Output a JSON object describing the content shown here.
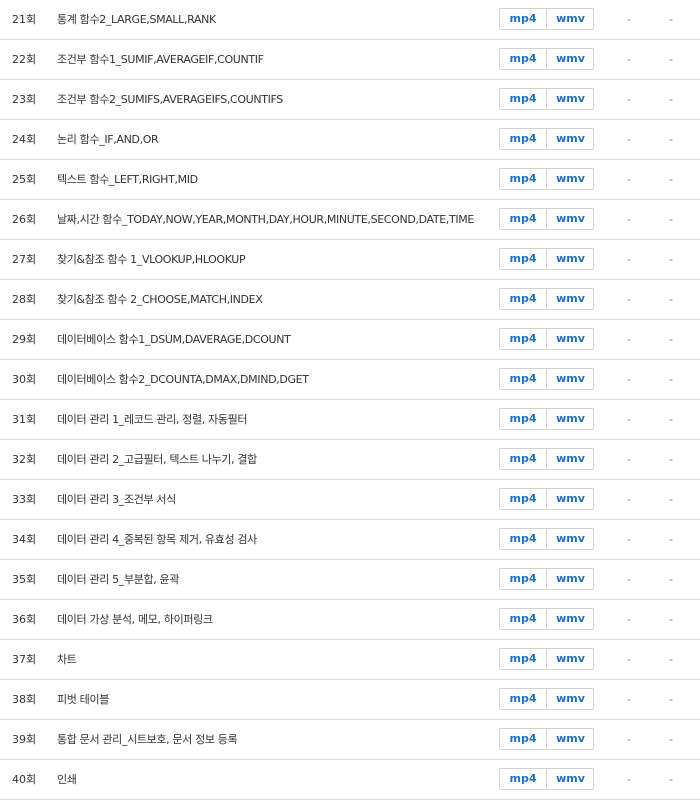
{
  "lectures": [
    {
      "num": "21회",
      "title": "통계 함수2_LARGE,SMALL,RANK",
      "mp4": "mp4",
      "wmv": "wmv",
      "col1": "-",
      "col2": "-"
    },
    {
      "num": "22회",
      "title": "조건부 함수1_SUMIF,AVERAGEIF,COUNTIF",
      "mp4": "mp4",
      "wmv": "wmv",
      "col1": "-",
      "col2": "-"
    },
    {
      "num": "23회",
      "title": "조건부 함수2_SUMIFS,AVERAGEIFS,COUNTIFS",
      "mp4": "mp4",
      "wmv": "wmv",
      "col1": "-",
      "col2": "-"
    },
    {
      "num": "24회",
      "title": "논리 함수_IF,AND,OR",
      "mp4": "mp4",
      "wmv": "wmv",
      "col1": "-",
      "col2": "-"
    },
    {
      "num": "25회",
      "title": "텍스트 함수_LEFT,RIGHT,MID",
      "mp4": "mp4",
      "wmv": "wmv",
      "col1": "-",
      "col2": "-"
    },
    {
      "num": "26회",
      "title": "날짜,시간 함수_TODAY,NOW,YEAR,MONTH,DAY,HOUR,MINUTE,SECOND,DATE,TIME",
      "mp4": "mp4",
      "wmv": "wmv",
      "col1": "-",
      "col2": "-"
    },
    {
      "num": "27회",
      "title": "찾기&참조 함수 1_VLOOKUP,HLOOKUP",
      "mp4": "mp4",
      "wmv": "wmv",
      "col1": "-",
      "col2": "-"
    },
    {
      "num": "28회",
      "title": "찾기&참조 함수 2_CHOOSE,MATCH,INDEX",
      "mp4": "mp4",
      "wmv": "wmv",
      "col1": "-",
      "col2": "-"
    },
    {
      "num": "29회",
      "title": "데이터베이스 함수1_DSUM,DAVERAGE,DCOUNT",
      "mp4": "mp4",
      "wmv": "wmv",
      "col1": "-",
      "col2": "-"
    },
    {
      "num": "30회",
      "title": "데이터베이스 함수2_DCOUNTA,DMAX,DMIND,DGET",
      "mp4": "mp4",
      "wmv": "wmv",
      "col1": "-",
      "col2": "-"
    },
    {
      "num": "31회",
      "title": "데이터 관리 1_레코드 관리, 정렬, 자동필터",
      "mp4": "mp4",
      "wmv": "wmv",
      "col1": "-",
      "col2": "-"
    },
    {
      "num": "32회",
      "title": "데이터 관리 2_고급필터, 텍스트 나누기, 결합",
      "mp4": "mp4",
      "wmv": "wmv",
      "col1": "-",
      "col2": "-"
    },
    {
      "num": "33회",
      "title": "데이터 관리 3_조건부 서식",
      "mp4": "mp4",
      "wmv": "wmv",
      "col1": "-",
      "col2": "-"
    },
    {
      "num": "34회",
      "title": "데이터 관리 4_중복된 항목 제거, 유효성 검사",
      "mp4": "mp4",
      "wmv": "wmv",
      "col1": "-",
      "col2": "-"
    },
    {
      "num": "35회",
      "title": "데이터 관리 5_부분합, 윤곽",
      "mp4": "mp4",
      "wmv": "wmv",
      "col1": "-",
      "col2": "-"
    },
    {
      "num": "36회",
      "title": "데이터 가상 분석, 메모, 하이퍼링크",
      "mp4": "mp4",
      "wmv": "wmv",
      "col1": "-",
      "col2": "-"
    },
    {
      "num": "37회",
      "title": "차트",
      "mp4": "mp4",
      "wmv": "wmv",
      "col1": "-",
      "col2": "-"
    },
    {
      "num": "38회",
      "title": "피벗 테이블",
      "mp4": "mp4",
      "wmv": "wmv",
      "col1": "-",
      "col2": "-"
    },
    {
      "num": "39회",
      "title": "통합 문서 관리_시트보호, 문서 정보 등록",
      "mp4": "mp4",
      "wmv": "wmv",
      "col1": "-",
      "col2": "-"
    },
    {
      "num": "40회",
      "title": "인쇄",
      "mp4": "mp4",
      "wmv": "wmv",
      "col1": "-",
      "col2": "-"
    }
  ],
  "colors": {
    "link": "#1f6fc5",
    "border": "#dddddd",
    "text": "#333333"
  }
}
